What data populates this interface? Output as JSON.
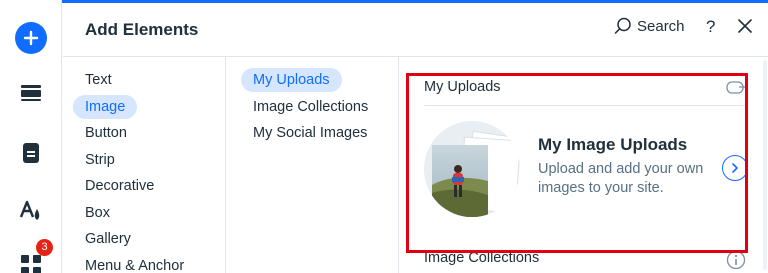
{
  "colors": {
    "accent": "#116dff",
    "badge": "#e62214",
    "highlight_border": "#e00012"
  },
  "rail": {
    "icons": [
      "add-elements-icon",
      "sections-icon",
      "pages-icon",
      "theme-icon",
      "apps-icon"
    ],
    "apps_badge": "3"
  },
  "header": {
    "title": "Add Elements",
    "search_label": "Search",
    "help_label": "?"
  },
  "categories": [
    {
      "label": "Text",
      "active": false
    },
    {
      "label": "Image",
      "active": true
    },
    {
      "label": "Button",
      "active": false
    },
    {
      "label": "Strip",
      "active": false
    },
    {
      "label": "Decorative",
      "active": false
    },
    {
      "label": "Box",
      "active": false
    },
    {
      "label": "Gallery",
      "active": false
    },
    {
      "label": "Menu & Anchor",
      "active": false
    }
  ],
  "subcategories": [
    {
      "label": "My Uploads",
      "active": true
    },
    {
      "label": "Image Collections",
      "active": false
    },
    {
      "label": "My Social Images",
      "active": false
    }
  ],
  "content": {
    "section_uploads": "My Uploads",
    "card": {
      "title": "My Image Uploads",
      "description": "Upload and add your own images to your site."
    },
    "section_collections": "Image Collections"
  }
}
